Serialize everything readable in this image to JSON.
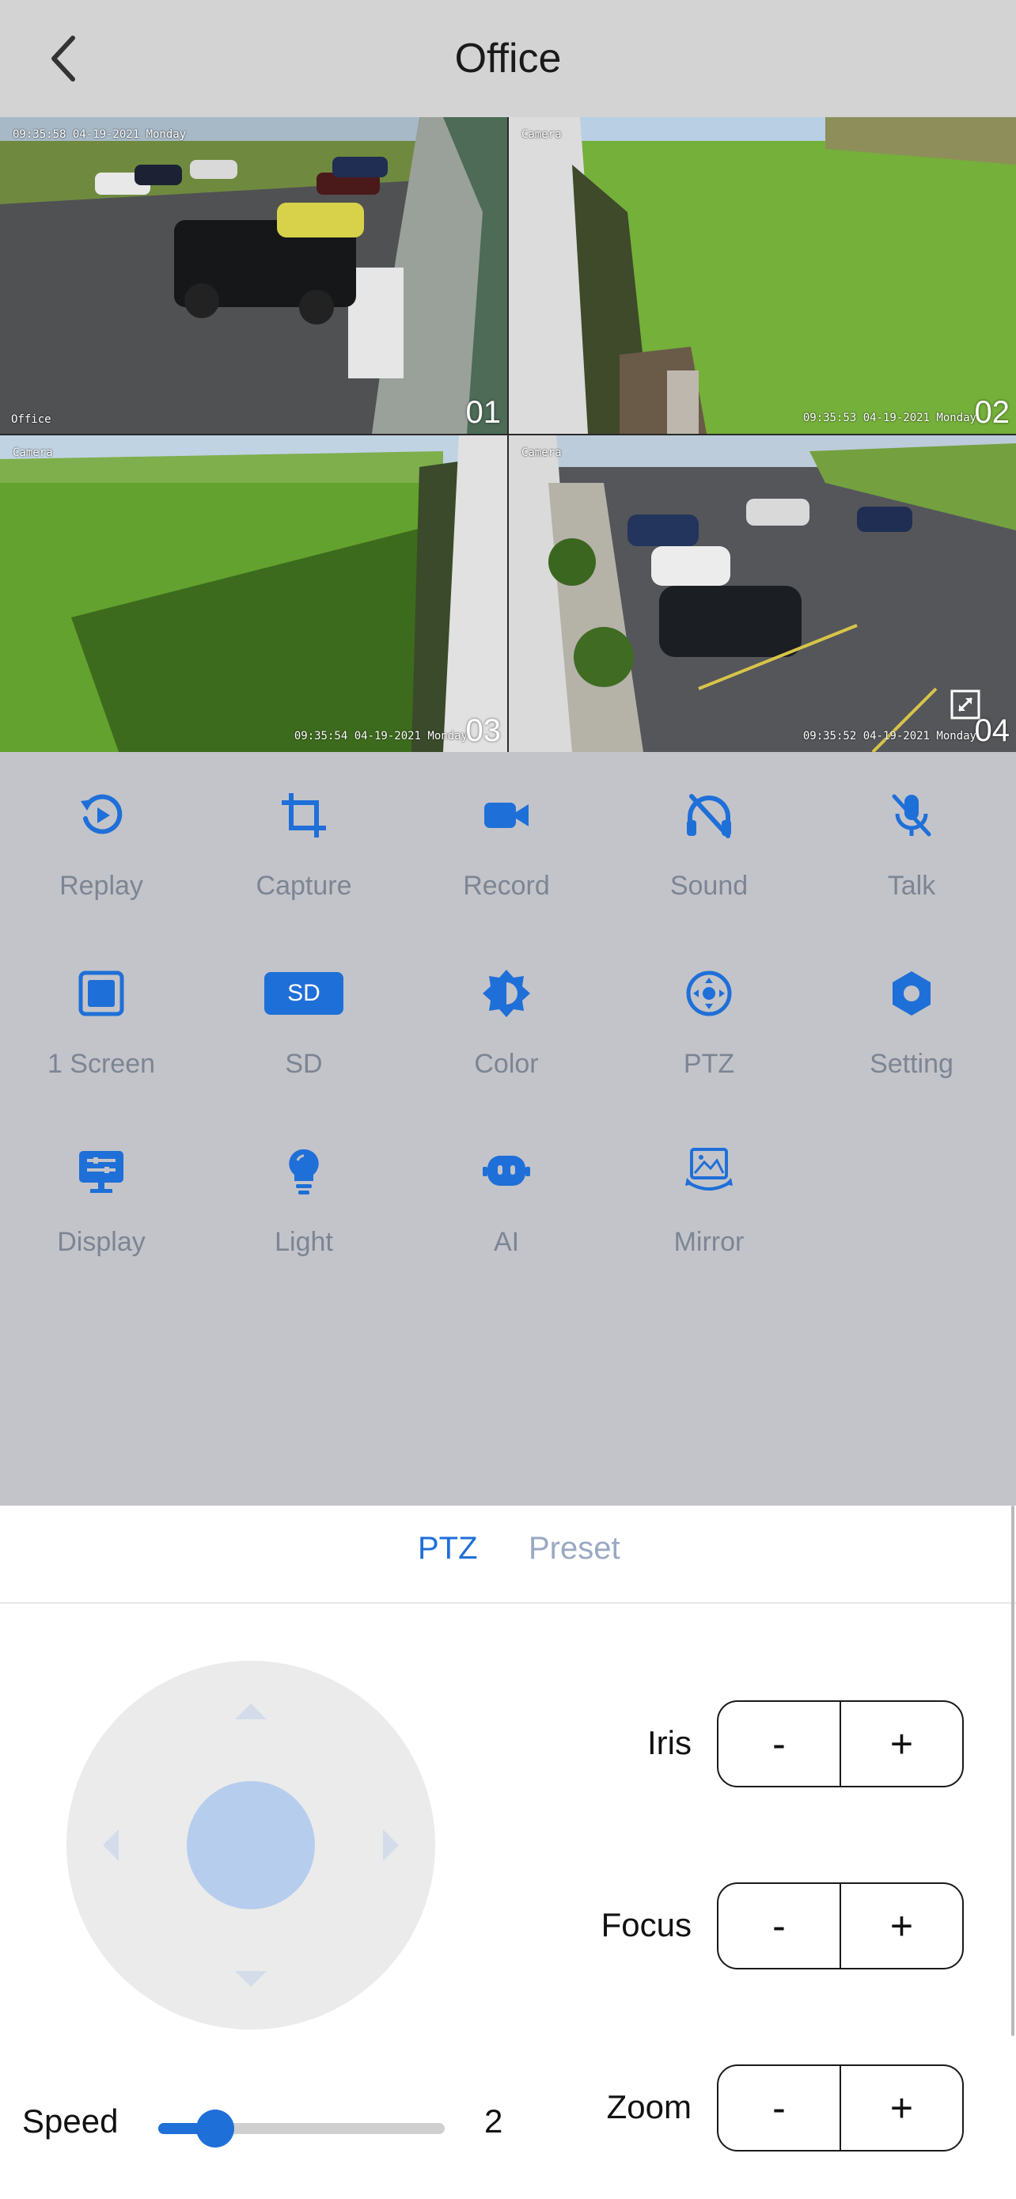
{
  "header": {
    "title": "Office"
  },
  "cameras": [
    {
      "osd_top": "09:35:58 04-19-2021 Monday",
      "osd_bottom": "Office",
      "number": "01"
    },
    {
      "osd_top": "Camera",
      "osd_bottom": "09:35:53 04-19-2021 Monday",
      "number": "02"
    },
    {
      "osd_top": "Camera",
      "osd_bottom": "09:35:54 04-19-2021 Monday",
      "number": "03"
    },
    {
      "osd_top": "Camera",
      "osd_bottom": "09:35:52 04-19-2021 Monday",
      "number": "04"
    }
  ],
  "controls": [
    {
      "label": "Replay",
      "icon": "replay-icon"
    },
    {
      "label": "Capture",
      "icon": "crop-icon"
    },
    {
      "label": "Record",
      "icon": "video-camera-icon"
    },
    {
      "label": "Sound",
      "icon": "sound-off-icon"
    },
    {
      "label": "Talk",
      "icon": "mic-off-icon"
    },
    {
      "label": "1 Screen",
      "icon": "single-screen-icon"
    },
    {
      "label": "SD",
      "icon": "sd-card-icon",
      "badge": "SD"
    },
    {
      "label": "Color",
      "icon": "brightness-icon"
    },
    {
      "label": "PTZ",
      "icon": "ptz-icon"
    },
    {
      "label": "Setting",
      "icon": "gear-icon"
    },
    {
      "label": "Display",
      "icon": "display-icon"
    },
    {
      "label": "Light",
      "icon": "lightbulb-icon"
    },
    {
      "label": "AI",
      "icon": "ai-robot-icon"
    },
    {
      "label": "Mirror",
      "icon": "mirror-icon"
    }
  ],
  "sheet": {
    "tabs": [
      {
        "label": "PTZ",
        "active": true
      },
      {
        "label": "Preset",
        "active": false
      }
    ],
    "adjustments": [
      {
        "label": "Iris",
        "minus": "-",
        "plus": "+"
      },
      {
        "label": "Focus",
        "minus": "-",
        "plus": "+"
      },
      {
        "label": "Zoom",
        "minus": "-",
        "plus": "+"
      }
    ],
    "speed": {
      "label": "Speed",
      "value": "2",
      "fraction": 0.2
    }
  },
  "colors": {
    "accent": "#1f6fd8",
    "label_gray": "#7d8594",
    "selected_border": "#e0283a",
    "inactive_tab": "#9aa9c2"
  }
}
